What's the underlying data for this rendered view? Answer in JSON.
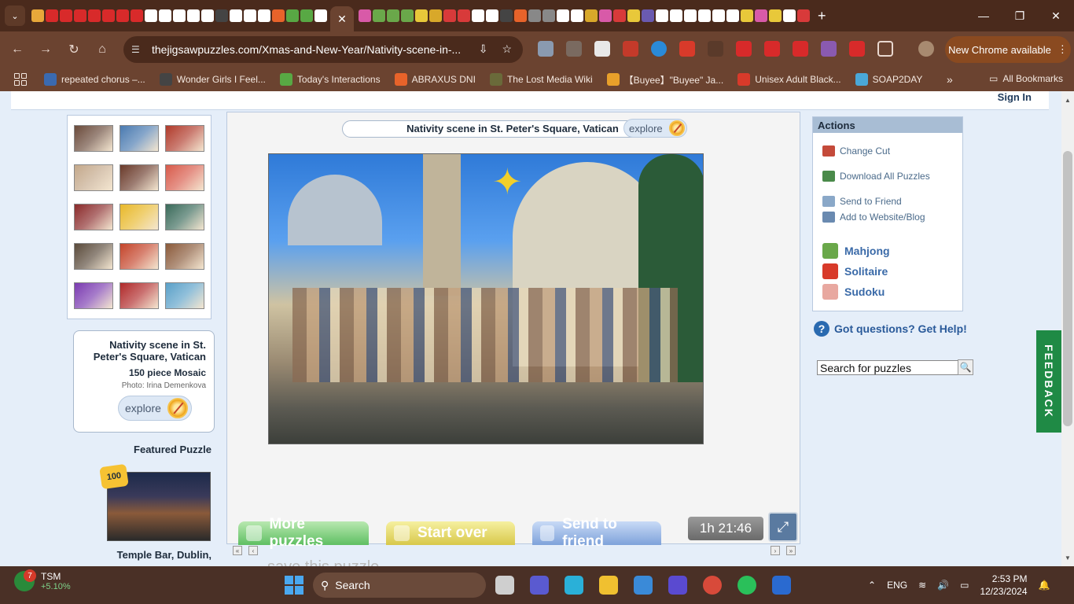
{
  "browser": {
    "active_tab_close": "✕",
    "new_tab": "+",
    "window_controls": {
      "minimize": "—",
      "restore": "❐",
      "close": "✕"
    },
    "url": "thejigsawpuzzles.com/Xmas-and-New-Year/Nativity-scene-in-...",
    "new_chrome": "New Chrome available",
    "bookmarks": [
      {
        "label": "repeated chorus –...",
        "color": "#3a6ab0"
      },
      {
        "label": "Wonder Girls I Feel...",
        "color": "#444444"
      },
      {
        "label": "Today's Interactions",
        "color": "#58a844"
      },
      {
        "label": "ABRAXUS DNI",
        "color": "#e8632a"
      },
      {
        "label": "The Lost Media Wiki",
        "color": "#6a6a3a"
      },
      {
        "label": "【Buyee】\"Buyee\" Ja...",
        "color": "#e8a02a"
      },
      {
        "label": "Unisex Adult Black...",
        "color": "#d83a2a"
      },
      {
        "label": "SOAP2DAY",
        "color": "#4aa8d8"
      }
    ],
    "bookmarks_overflow": "»",
    "all_bookmarks": "All Bookmarks"
  },
  "site": {
    "sign_in": "Sign In",
    "puzzle_info": {
      "title": "Nativity scene in St. Peter's Square, Vatican",
      "pieces": "150 piece Mosaic",
      "photo_credit": "Photo: Irina Demenkova",
      "explore": "explore"
    },
    "featured_label": "Featured Puzzle",
    "featured_badge": "100",
    "featured_title": "Temple Bar, Dublin,",
    "main_title": "Nativity scene in St. Peter's Square, Vatican",
    "main_explore": "explore",
    "controls": {
      "more": "More puzzles",
      "start_over": "Start over",
      "send": "Send to friend"
    },
    "timer": "1h 21:46",
    "save_hint": "save this puzzle",
    "actions": {
      "header": "Actions",
      "change_cut": "Change Cut",
      "download_all": "Download All Puzzles",
      "send_friend": "Send to Friend",
      "add_website": "Add to Website/Blog"
    },
    "games": [
      "Mahjong",
      "Solitaire",
      "Sudoku"
    ],
    "help": "Got questions? Get Help!",
    "search_value": "Search for puzzles",
    "feedback": "FEEDBACK"
  },
  "thumb_colors": [
    "#6a4a3a",
    "#4a7ab0",
    "#b03a2a",
    "#c4a88a",
    "#6a3a2a",
    "#d85a4a",
    "#8a2a2a",
    "#e8b82a",
    "#3a6a5a",
    "#5a4a3a",
    "#c4442a",
    "#8a5a3a",
    "#7a3ab0",
    "#b02a2a",
    "#5aa0c8"
  ],
  "taskbar": {
    "stock_count": "7",
    "stock_name": "TSM",
    "stock_change": "+5.10%",
    "search": "Search",
    "language": "ENG",
    "time": "2:53 PM",
    "date": "12/23/2024"
  }
}
